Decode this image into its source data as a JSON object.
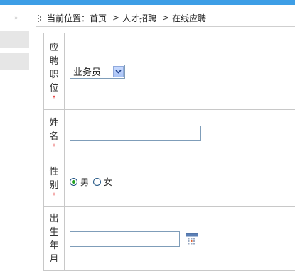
{
  "header": {
    "sidebar_arrow": "»"
  },
  "breadcrumb": {
    "prefix": "当前位置：",
    "items": [
      "首页",
      "人才招聘",
      "在线应聘"
    ],
    "separator": ">"
  },
  "form": {
    "position": {
      "label_chars": [
        "应",
        "聘",
        "职",
        "位"
      ],
      "required_mark": "*",
      "selected_value": "业务员"
    },
    "name": {
      "label_chars": [
        "姓",
        "名"
      ],
      "required_mark": "*",
      "value": ""
    },
    "gender": {
      "label_chars": [
        "性",
        "别"
      ],
      "required_mark": "*",
      "options": [
        "男",
        "女"
      ],
      "selected": "男"
    },
    "birth": {
      "label_chars": [
        "出",
        "生",
        "年",
        "月"
      ],
      "value": ""
    }
  },
  "colors": {
    "accent": "#3d9ee6",
    "required": "#e02020",
    "border": "#c8c8c8",
    "input_border": "#7f9db9"
  }
}
